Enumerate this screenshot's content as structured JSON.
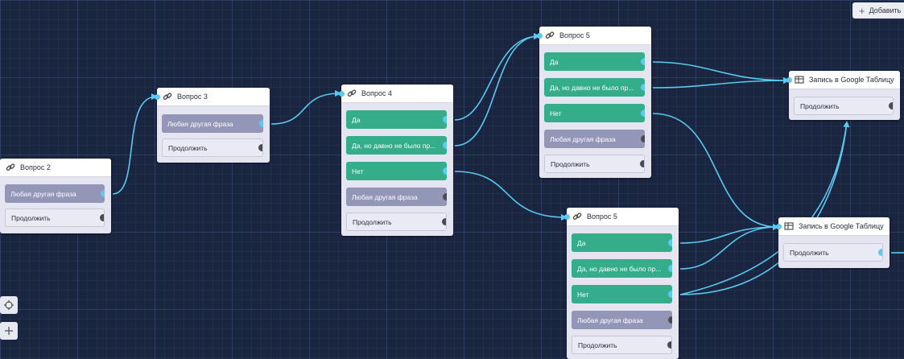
{
  "toolbar": {
    "add_label": "Добавить"
  },
  "nodes": {
    "q2": {
      "title": "Вопрос 2",
      "opt0": "Любая другая фраза",
      "cont": "Продолжить"
    },
    "q3": {
      "title": "Вопрос 3",
      "opt0": "Любая другая фраза",
      "cont": "Продолжить"
    },
    "q4": {
      "title": "Вопрос 4",
      "opt0": "Да",
      "opt1": "Да, но давно не было пр...",
      "opt2": "Нет",
      "opt3": "Любая другая фраза",
      "cont": "Продолжить"
    },
    "q5a": {
      "title": "Вопрос 5",
      "opt0": "Да",
      "opt1": "Да, но давно не было пр...",
      "opt2": "Нет",
      "opt3": "Любая другая фраза",
      "cont": "Продолжить"
    },
    "q5b": {
      "title": "Вопрос 5",
      "opt0": "Да",
      "opt1": "Да, но давно не было пр...",
      "opt2": "Нет",
      "opt3": "Любая другая фраза",
      "cont": "Продолжить"
    },
    "gs1": {
      "title": "Запись в Google Таблицу",
      "cont": "Продолжить"
    },
    "gs2": {
      "title": "Запись в Google Таблицу",
      "cont": "Продолжить"
    }
  },
  "colors": {
    "canvas": "#1a2540",
    "edge": "#5bc9f0",
    "option_green": "#35ad8a",
    "option_gray": "#9396b6"
  },
  "icons": {
    "question_node": "link-icon",
    "sheet_node": "table-icon",
    "recenter": "crosshair-icon",
    "zoom_in": "plus-icon"
  }
}
